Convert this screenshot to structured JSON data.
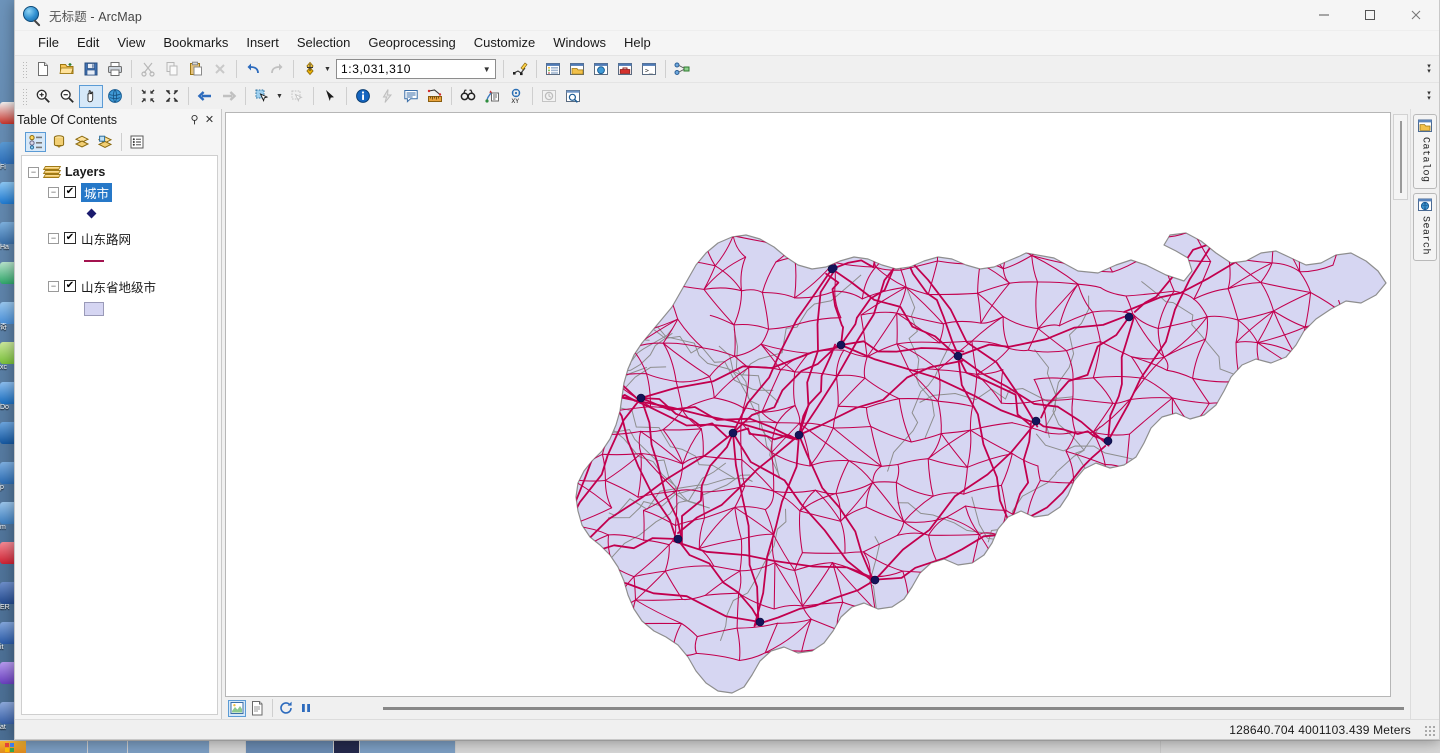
{
  "window": {
    "title_document": "无标题",
    "title_app": "ArcMap",
    "title_separator": " - ",
    "app_icon": "arcmap-globe-icon",
    "minimize_label": "—",
    "maximize_label": "□",
    "close_label": "✕"
  },
  "menubar": {
    "items": [
      {
        "label": "File",
        "name": "menu-file"
      },
      {
        "label": "Edit",
        "name": "menu-edit"
      },
      {
        "label": "View",
        "name": "menu-view"
      },
      {
        "label": "Bookmarks",
        "name": "menu-bookmarks"
      },
      {
        "label": "Insert",
        "name": "menu-insert"
      },
      {
        "label": "Selection",
        "name": "menu-selection"
      },
      {
        "label": "Geoprocessing",
        "name": "menu-geoprocessing"
      },
      {
        "label": "Customize",
        "name": "menu-customize"
      },
      {
        "label": "Windows",
        "name": "menu-windows"
      },
      {
        "label": "Help",
        "name": "menu-help"
      }
    ]
  },
  "standard_toolbar": {
    "scale": {
      "value": "1:3,031,310",
      "dropdown_icon": "chevron-down-icon"
    },
    "buttons": [
      {
        "name": "new-map-icon",
        "tooltip": "New"
      },
      {
        "name": "open-icon",
        "tooltip": "Open"
      },
      {
        "name": "save-icon",
        "tooltip": "Save"
      },
      {
        "name": "print-icon",
        "tooltip": "Print"
      },
      {
        "name": "cut-icon",
        "tooltip": "Cut"
      },
      {
        "name": "copy-icon",
        "tooltip": "Copy"
      },
      {
        "name": "paste-icon",
        "tooltip": "Paste"
      },
      {
        "name": "delete-icon",
        "tooltip": "Delete"
      },
      {
        "name": "undo-icon",
        "tooltip": "Undo"
      },
      {
        "name": "redo-icon",
        "tooltip": "Redo"
      },
      {
        "name": "add-data-icon",
        "tooltip": "Add Data"
      },
      {
        "name": "editor-toolbar-icon",
        "tooltip": "Editor Toolbar"
      },
      {
        "name": "table-of-contents-icon",
        "tooltip": "Table Of Contents"
      },
      {
        "name": "catalog-window-icon",
        "tooltip": "Catalog"
      },
      {
        "name": "search-window-icon",
        "tooltip": "Search"
      },
      {
        "name": "arctoolbox-icon",
        "tooltip": "ArcToolbox"
      },
      {
        "name": "python-window-icon",
        "tooltip": "Python"
      },
      {
        "name": "modelbuilder-icon",
        "tooltip": "ModelBuilder"
      }
    ],
    "overflow_icon": "toolbar-overflow-icon"
  },
  "tools_toolbar": {
    "buttons": [
      {
        "name": "zoom-in-icon",
        "tooltip": "Zoom In",
        "selected": false
      },
      {
        "name": "zoom-out-icon",
        "tooltip": "Zoom Out",
        "selected": false
      },
      {
        "name": "pan-icon",
        "tooltip": "Pan",
        "selected": true
      },
      {
        "name": "full-extent-icon",
        "tooltip": "Full Extent",
        "selected": false
      },
      {
        "name": "fixed-zoom-in-icon",
        "tooltip": "Fixed Zoom In",
        "selected": false
      },
      {
        "name": "fixed-zoom-out-icon",
        "tooltip": "Fixed Zoom Out",
        "selected": false
      },
      {
        "name": "go-back-extent-icon",
        "tooltip": "Go Back To Previous Extent",
        "selected": false
      },
      {
        "name": "go-forward-extent-icon",
        "tooltip": "Go To Next Extent",
        "selected": false
      },
      {
        "name": "select-features-icon",
        "tooltip": "Select Features",
        "selected": false
      },
      {
        "name": "clear-selection-icon",
        "tooltip": "Clear Selected Features",
        "selected": false
      },
      {
        "name": "select-elements-icon",
        "tooltip": "Select Elements",
        "selected": false
      },
      {
        "name": "identify-icon",
        "tooltip": "Identify",
        "selected": false
      },
      {
        "name": "hyperlink-icon",
        "tooltip": "Hyperlink",
        "selected": false
      },
      {
        "name": "html-popup-icon",
        "tooltip": "HTML Popup",
        "selected": false
      },
      {
        "name": "measure-icon",
        "tooltip": "Measure",
        "selected": false
      },
      {
        "name": "find-icon",
        "tooltip": "Find",
        "selected": false
      },
      {
        "name": "find-route-icon",
        "tooltip": "Find Route",
        "selected": false
      },
      {
        "name": "go-to-xy-icon",
        "tooltip": "Go To XY",
        "selected": false
      },
      {
        "name": "time-slider-icon",
        "tooltip": "Time Slider",
        "selected": false
      },
      {
        "name": "create-viewer-window-icon",
        "tooltip": "Create Viewer Window",
        "selected": false
      }
    ],
    "overflow_icon": "toolbar-overflow-icon"
  },
  "toc": {
    "title": "Table Of Contents",
    "pin_icon": "pin-icon",
    "close_icon": "close-icon",
    "toolbar": [
      {
        "name": "list-by-drawing-order-icon",
        "label": "List By Drawing Order",
        "selected": true
      },
      {
        "name": "list-by-source-icon",
        "label": "List By Source",
        "selected": false
      },
      {
        "name": "list-by-visibility-icon",
        "label": "List By Visibility",
        "selected": false
      },
      {
        "name": "list-by-selection-icon",
        "label": "List By Selection",
        "selected": false
      },
      {
        "name": "toc-options-icon",
        "label": "Options",
        "selected": false
      }
    ],
    "root": {
      "label": "Layers",
      "expander": "−",
      "icon": "layers-stack-icon"
    },
    "layers": [
      {
        "label": "城市",
        "expander": "−",
        "checked": true,
        "check_mark": "✔",
        "selected": true,
        "symbol_type": "point",
        "symbol_color": "#1b1b6e"
      },
      {
        "label": "山东路网",
        "expander": "−",
        "checked": true,
        "check_mark": "✔",
        "selected": false,
        "symbol_type": "line",
        "symbol_color": "#a3134f"
      },
      {
        "label": "山东省地级市",
        "expander": "−",
        "checked": true,
        "check_mark": "✔",
        "selected": false,
        "symbol_type": "polygon",
        "symbol_color": "#d5d5f2"
      }
    ]
  },
  "map": {
    "background_color": "#ffffff",
    "polygon_fill": "#d6d6f2",
    "polygon_outline": "#8e8e8e",
    "road_color": "#c2004e",
    "city_point_color": "#14145a",
    "view_buttons": [
      {
        "name": "data-view-button",
        "label": "Data View",
        "selected": true
      },
      {
        "name": "layout-view-button",
        "label": "Layout View",
        "selected": false
      },
      {
        "name": "refresh-view-button",
        "label": "Refresh View",
        "selected": false
      },
      {
        "name": "pause-drawing-button",
        "label": "Pause Drawing",
        "selected": false
      }
    ]
  },
  "right_dock": {
    "tabs": [
      {
        "label": "Catalog",
        "name": "catalog-tab",
        "icon": "catalog-icon"
      },
      {
        "label": "Search",
        "name": "search-tab",
        "icon": "search-globe-icon"
      }
    ]
  },
  "statusbar": {
    "coordinates": "128640.704  4001103.439 Meters"
  },
  "desktop": {
    "icons": [
      {
        "label": "",
        "color1": "#c9342b",
        "color2": "#f2f2f2"
      },
      {
        "label": "Fi",
        "color1": "#2e6fba",
        "color2": "#5b9bd5"
      },
      {
        "label": "",
        "color1": "#1f7ad1",
        "color2": "#8ec9f5"
      },
      {
        "label": "Ha",
        "color1": "#3a6fa8",
        "color2": "#7fb2e0"
      },
      {
        "label": "",
        "color1": "#2fa86a",
        "color2": "#b9e5cd"
      },
      {
        "label": "奇",
        "color1": "#4a90d9",
        "color2": "#9ac8ef"
      },
      {
        "label": "xc",
        "color1": "#7ac13a",
        "color2": "#cdea9e"
      },
      {
        "label": "Do",
        "color1": "#1b6fc1",
        "color2": "#8dbff0"
      },
      {
        "label": "",
        "color1": "#1457a0",
        "color2": "#6ea7e0"
      },
      {
        "label": "p",
        "color1": "#2b6cb3",
        "color2": "#7fb0e2"
      },
      {
        "label": "m",
        "color1": "#3e7fc0",
        "color2": "#9cc6ec"
      },
      {
        "label": "",
        "color1": "#cf2233",
        "color2": "#f58b95"
      },
      {
        "label": "ER",
        "color1": "#244b8f",
        "color2": "#6f90cc"
      },
      {
        "label": "it",
        "color1": "#2b5ba8",
        "color2": "#85a8dd"
      },
      {
        "label": "",
        "color1": "#6a3fbf",
        "color2": "#b79cf0"
      },
      {
        "label": "at",
        "color1": "#3860a8",
        "color2": "#8fabdd"
      }
    ]
  },
  "taskbar": {
    "start_icon": "windows-start-icon",
    "items": [
      {
        "name": "taskbar-item-1",
        "width": 62,
        "style": "normal"
      },
      {
        "name": "taskbar-item-2",
        "width": 40,
        "style": "normal"
      },
      {
        "name": "taskbar-item-3",
        "width": 82,
        "style": "normal"
      },
      {
        "name": "taskbar-item-4",
        "width": 36,
        "style": "gap"
      },
      {
        "name": "taskbar-item-5",
        "width": 88,
        "style": "active"
      },
      {
        "name": "taskbar-item-6",
        "width": 26,
        "style": "dark"
      },
      {
        "name": "taskbar-item-7",
        "width": 96,
        "style": "normal"
      }
    ]
  }
}
